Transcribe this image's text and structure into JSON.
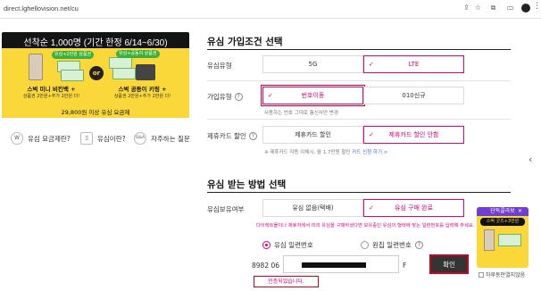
{
  "browser": {
    "url": "direct.lghellovision.net/cu",
    "minimize": "—",
    "restore": "❐",
    "close": "✕"
  },
  "banner": {
    "headline": "선착순 1,000명 (기간 한정 6/14~6/30)",
    "tag_left": "유심+2만원 상품권",
    "tag_right": "유심+공동이 상품권",
    "or_label": "or",
    "product_left": "스벅 미니 비킨백 +",
    "product_left_sub": "상품권 2만원+추가 2만원 더!",
    "product_right": "스벅 공동이 키링 +",
    "product_right_sub": "상품권 2만원+추가 2만원 더!",
    "footer": "29,800원 이상 유심 요금제"
  },
  "quick_links": [
    {
      "icon": "W",
      "label": "유심 요금제란?"
    },
    {
      "icon": "▯",
      "label": "유심이란?"
    },
    {
      "icon": "Q&A",
      "label": "자주하는 질문"
    }
  ],
  "section1": {
    "title": "유심 가입조건 선택",
    "rows": [
      {
        "label": "유심유형",
        "options": [
          "5G",
          "LTE"
        ],
        "selected": 1
      },
      {
        "label": "가입유형",
        "options": [
          "번호이동",
          "010신규"
        ],
        "selected": 0,
        "note": "사용하는 번호 그대로 통신사만 변경"
      },
      {
        "label": "제휴카드 할인",
        "options": [
          "제휴카드 할인",
          "제휴카드 할인 안함"
        ],
        "selected": 1,
        "note": "※ 제휴카드 자동 이체시, 월 1,7만원 할인",
        "note_link": "카드 신청 하기 >"
      }
    ]
  },
  "section2": {
    "title": "유심 받는 방법 선택",
    "row_label": "유심보유여부",
    "options": [
      "유심 없음(택배)",
      "유심 구매 완료"
    ],
    "selected": 1,
    "warning": "다이렉트몰이나 제휴처에서 미리 유심을 구매하셨다면 보유중인 유심의 형태에 맞는 일련번호를 입력해 주세요.",
    "radio_options": [
      "유심 일련번호",
      "원칩 일련번호"
    ],
    "radio_selected": 0,
    "serial_prefix": "8982 06",
    "serial_suffix": "F",
    "confirm_label": "확인",
    "confirm_msg": "인증되었습니다."
  },
  "promo": {
    "head": "단독콜라보",
    "sub": "스벅 굿즈+3만원",
    "close": "✕",
    "hide_today": "하루동안열지않음"
  },
  "colors": {
    "accent": "#e6007e",
    "banner_bg": "#fbd83a",
    "button_dark": "#333333",
    "highlight_frame": "#d0021b"
  }
}
